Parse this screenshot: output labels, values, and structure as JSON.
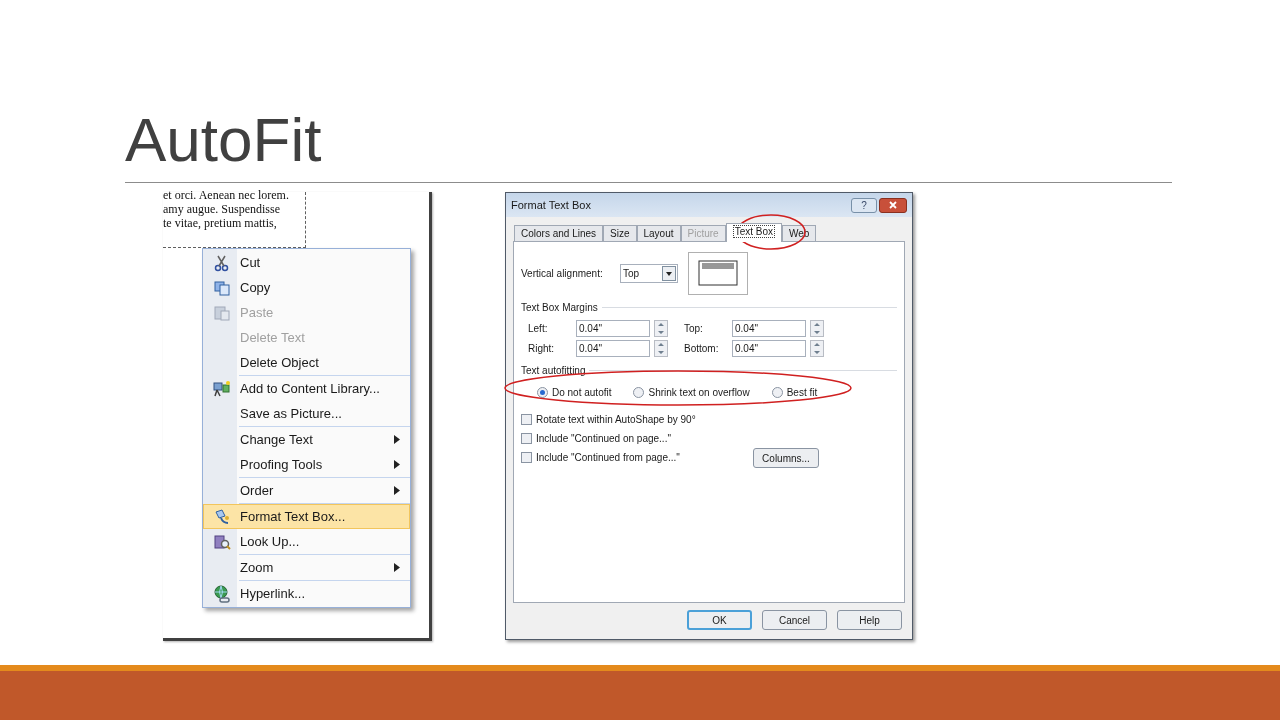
{
  "slide": {
    "title": "AutoFit"
  },
  "document": {
    "lines": [
      "et orci. Aenean nec lorem.",
      "amy augue. Suspendisse",
      "te vitae, pretium mattis,"
    ]
  },
  "context_menu": {
    "groups": [
      [
        {
          "label": "Cut",
          "disabled": false,
          "selected": false,
          "submenu": false
        },
        {
          "label": "Copy",
          "disabled": false,
          "selected": false,
          "submenu": false
        },
        {
          "label": "Paste",
          "disabled": true,
          "selected": false,
          "submenu": false
        },
        {
          "label": "Delete Text",
          "disabled": true,
          "selected": false,
          "submenu": false
        },
        {
          "label": "Delete Object",
          "disabled": false,
          "selected": false,
          "submenu": false
        }
      ],
      [
        {
          "label": "Add to Content Library...",
          "disabled": false,
          "selected": false,
          "submenu": false
        },
        {
          "label": "Save as Picture...",
          "disabled": false,
          "selected": false,
          "submenu": false
        }
      ],
      [
        {
          "label": "Change Text",
          "disabled": false,
          "selected": false,
          "submenu": true
        },
        {
          "label": "Proofing Tools",
          "disabled": false,
          "selected": false,
          "submenu": true
        }
      ],
      [
        {
          "label": "Order",
          "disabled": false,
          "selected": false,
          "submenu": true
        }
      ],
      [
        {
          "label": "Format Text Box...",
          "disabled": false,
          "selected": true,
          "submenu": false
        },
        {
          "label": "Look Up...",
          "disabled": false,
          "selected": false,
          "submenu": false
        }
      ],
      [
        {
          "label": "Zoom",
          "disabled": false,
          "selected": false,
          "submenu": true
        }
      ],
      [
        {
          "label": "Hyperlink...",
          "disabled": false,
          "selected": false,
          "submenu": false
        }
      ]
    ]
  },
  "dialog": {
    "title": "Format Text Box",
    "help_button": "?",
    "tabs": [
      {
        "label": "Colors and Lines",
        "selected": false,
        "disabled": false
      },
      {
        "label": "Size",
        "selected": false,
        "disabled": false
      },
      {
        "label": "Layout",
        "selected": false,
        "disabled": false
      },
      {
        "label": "Picture",
        "selected": false,
        "disabled": true
      },
      {
        "label": "Text Box",
        "selected": true,
        "disabled": false
      },
      {
        "label": "Web",
        "selected": false,
        "disabled": false
      }
    ],
    "vertical_alignment": {
      "label": "Vertical alignment:",
      "value": "Top"
    },
    "margins": {
      "heading": "Text Box Margins",
      "fields": [
        {
          "label": "Left:",
          "value": "0.04\""
        },
        {
          "label": "Top:",
          "value": "0.04\""
        },
        {
          "label": "Right:",
          "value": "0.04\""
        },
        {
          "label": "Bottom:",
          "value": "0.04\""
        }
      ]
    },
    "autofitting": {
      "heading": "Text autofitting",
      "options": [
        {
          "label": "Do not autofit",
          "selected": true
        },
        {
          "label": "Shrink text on overflow",
          "selected": false
        },
        {
          "label": "Best fit",
          "selected": false
        }
      ]
    },
    "checkboxes": [
      {
        "label": "Rotate text within AutoShape by 90°",
        "checked": false
      },
      {
        "label": "Include \"Continued on page...\"",
        "checked": false
      },
      {
        "label": "Include \"Continued from page...\"",
        "checked": false
      }
    ],
    "columns_button": "Columns...",
    "buttons": [
      {
        "label": "OK",
        "selected": true
      },
      {
        "label": "Cancel",
        "selected": false
      },
      {
        "label": "Help",
        "selected": false
      }
    ]
  }
}
